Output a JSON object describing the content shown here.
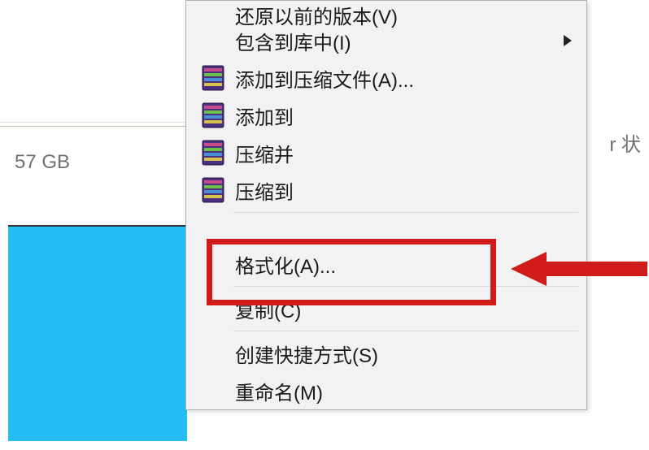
{
  "left": {
    "disk_size": "57 GB"
  },
  "right": {
    "status_fragment": "r 状"
  },
  "menu": {
    "restore_versions": "还原以前的版本(V)",
    "include_library": "包含到库中(I)",
    "add_to_archive": "添加到压缩文件(A)...",
    "add_to": "添加到",
    "compress_and": "压缩并",
    "compress_to": "压缩到",
    "format": "格式化(A)...",
    "copy": "复制(C)",
    "create_shortcut": "创建快捷方式(S)",
    "rename": "重命名(M)"
  },
  "icons": {
    "winrar": "winrar-icon",
    "submenu_arrow": "submenu-arrow"
  },
  "annotation": {
    "highlight_color": "#d11b1b"
  }
}
